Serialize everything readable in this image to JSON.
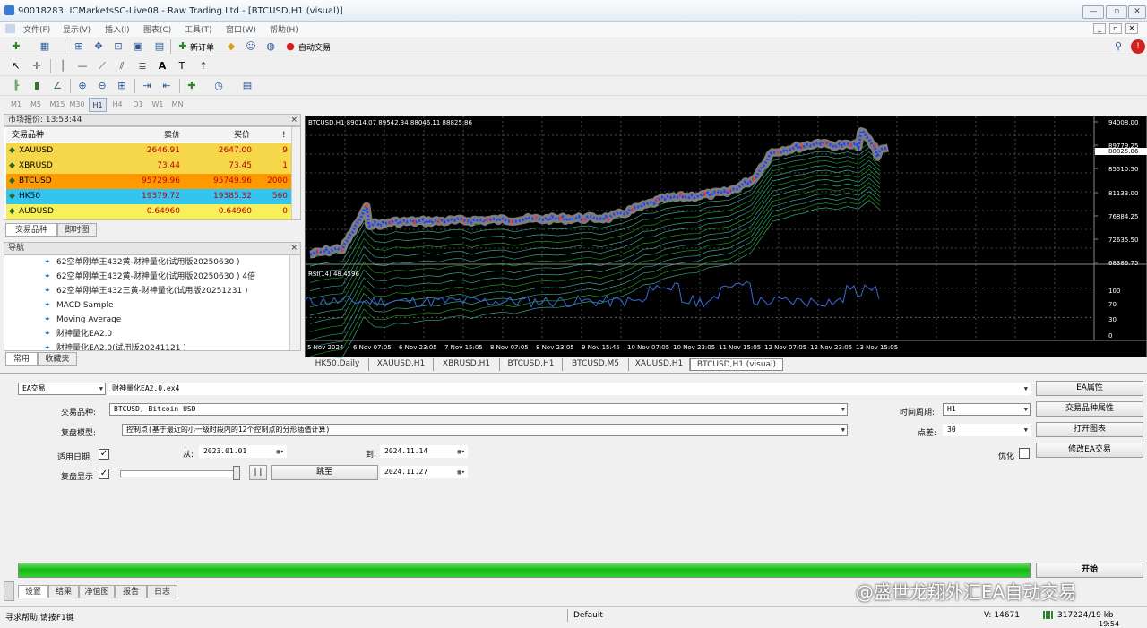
{
  "window": {
    "title": "90018283: ICMarketsSC-Live08 - Raw Trading Ltd - [BTCUSD,H1 (visual)]"
  },
  "menu": [
    "文件(F)",
    "显示(V)",
    "插入(I)",
    "图表(C)",
    "工具(T)",
    "窗口(W)",
    "帮助(H)"
  ],
  "toolbar": {
    "new_order": "新订单",
    "auto_trade": "自动交易"
  },
  "timeframes": [
    "M1",
    "M5",
    "M15",
    "M30",
    "H1",
    "H4",
    "D1",
    "W1",
    "MN"
  ],
  "market_watch": {
    "header": "市场报价: 13:53:44",
    "col_symbol": "交易品种",
    "col_bid": "卖价",
    "col_ask": "买价",
    "col_spread": "!",
    "rows": [
      {
        "symbol": "XAUUSD",
        "bid": "2646.91",
        "ask": "2647.00",
        "spread": "9",
        "bg": "#f7d74a"
      },
      {
        "symbol": "XBRUSD",
        "bid": "73.44",
        "ask": "73.45",
        "spread": "1",
        "bg": "#f7d74a"
      },
      {
        "symbol": "BTCUSD",
        "bid": "95729.96",
        "ask": "95749.96",
        "spread": "2000",
        "bg": "#ff9a00"
      },
      {
        "symbol": "HK50",
        "bid": "19379.72",
        "ask": "19385.32",
        "spread": "560",
        "bg": "#33c5f0"
      },
      {
        "symbol": "AUDUSD",
        "bid": "0.64960",
        "ask": "0.64960",
        "spread": "0",
        "bg": "#f7f05a"
      }
    ],
    "tabs": [
      "交易品种",
      "即时图"
    ]
  },
  "navigator": {
    "header": "导航",
    "items": [
      "62空单刚单王432黄-财神量化(试用版20250630 )",
      "62空单刚单王432黄-财神量化(试用版20250630 ) 4倍",
      "62空单刚单王432三黄-财神量化(试用版20251231 )",
      "MACD Sample",
      "Moving Average",
      "财神量化EA2.0",
      "财神量化EA2.0(试用版20241121 )"
    ],
    "tabs": [
      "常用",
      "收藏夹"
    ]
  },
  "chart": {
    "info": "BTCUSD,H1  89014.07 89542.34 88046.11 88825.86",
    "price_labels": [
      "94008.00",
      "89779.25",
      "88825.86",
      "85510.50",
      "81133.00",
      "76884.25",
      "72635.50",
      "68386.75"
    ],
    "rsi_label": "RSI(14) 48.4596",
    "rsi_levels": [
      "100",
      "70",
      "30",
      "0"
    ],
    "time_labels": [
      "5 Nov 2024",
      "6 Nov 07:05",
      "6 Nov 23:05",
      "7 Nov 15:05",
      "8 Nov 07:05",
      "8 Nov 23:05",
      "9 Nov 15:45",
      "10 Nov 07:05",
      "10 Nov 23:05",
      "11 Nov 15:05",
      "12 Nov 07:05",
      "12 Nov 23:05",
      "13 Nov 15:05"
    ],
    "tabs": [
      "HK50,Daily",
      "XAUUSD,H1",
      "XBRUSD,H1",
      "BTCUSD,H1",
      "BTCUSD,M5",
      "XAUUSD,H1",
      "BTCUSD,H1 (visual)"
    ]
  },
  "tester": {
    "mode": "EA交易",
    "ea_file": "财神量化EA2.0.ex4",
    "symbol_label": "交易品种:",
    "symbol_value": "BTCUSD, Bitcoin USD",
    "model_label": "复盘模型:",
    "model_value": "控制点(基于最近的小一级时段内的12个控制点的分形插值计算)",
    "use_date_label": "适用日期:",
    "from_label": "从:",
    "from_value": "2023.01.01",
    "to_label": "到:",
    "to_value": "2024.11.14",
    "visual_label": "复盘显示",
    "skip_button": "跳至",
    "skip_date": "2024.11.27",
    "period_label": "时间周期:",
    "period_value": "H1",
    "spread_label": "点差:",
    "spread_value": "30",
    "optimize_label": "优化",
    "buttons": {
      "ea_props": "EA属性",
      "symbol_props": "交易品种属性",
      "open_chart": "打开图表",
      "modify_ea": "修改EA交易",
      "start": "开始"
    },
    "progress": 1.0,
    "tabs": [
      "设置",
      "结果",
      "净值图",
      "报告",
      "日志"
    ]
  },
  "watermark": "@盛世龙翔外汇EA自动交易",
  "status": {
    "help": "寻求帮助,请按F1键",
    "profile": "Default",
    "volume": "V: 14671",
    "traffic": "317224/19 kb",
    "time": "19:54"
  }
}
